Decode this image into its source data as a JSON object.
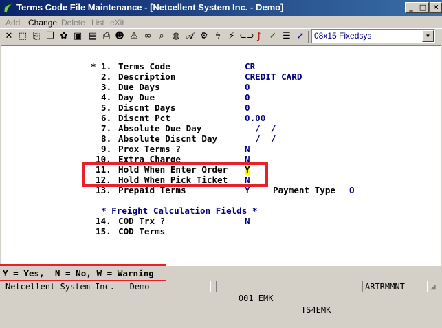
{
  "window": {
    "title": "Terms Code File Maintenance - [Netcellent System Inc. - Demo]",
    "buttons": {
      "minimize": "_",
      "maximize": "□",
      "close": "✕"
    }
  },
  "menu": {
    "add": "Add",
    "change": "Change",
    "delete": "Delete",
    "list": "List",
    "exit": "eXit"
  },
  "toolbar": {
    "font_selector": "08x15 Fixedsys"
  },
  "form": {
    "fields": [
      {
        "marker": "*",
        "num": "1.",
        "label": "Terms Code",
        "value": "CR"
      },
      {
        "marker": "",
        "num": "2.",
        "label": "Description",
        "value": "CREDIT CARD"
      },
      {
        "marker": "",
        "num": "3.",
        "label": "Due Days",
        "value": "0"
      },
      {
        "marker": "",
        "num": "4.",
        "label": "Day Due",
        "value": "0"
      },
      {
        "marker": "",
        "num": "5.",
        "label": "Discnt Days",
        "value": "0"
      },
      {
        "marker": "",
        "num": "6.",
        "label": "Discnt Pct",
        "value": "0.00"
      },
      {
        "marker": "",
        "num": "7.",
        "label": "Absolute Due Day",
        "value": "  /  /"
      },
      {
        "marker": "",
        "num": "8.",
        "label": "Absolute Discnt Day",
        "value": "  /  /"
      },
      {
        "marker": "",
        "num": "9.",
        "label": "Prox Terms ?",
        "value": "N"
      },
      {
        "marker": "",
        "num": "10.",
        "label": "Extra Charge",
        "value": "N"
      },
      {
        "marker": "",
        "num": "11.",
        "label": "Hold When Enter Order",
        "value": "Y"
      },
      {
        "marker": "",
        "num": "12.",
        "label": "Hold When Pick Ticket",
        "value": "N"
      },
      {
        "marker": "",
        "num": "13.",
        "label": "Prepaid Terms",
        "value": "Y"
      }
    ],
    "payment_type_label": "Payment Type",
    "payment_type_value": "O",
    "freight_heading": "* Freight Calculation Fields *",
    "freight_fields": [
      {
        "num": "14.",
        "label": "COD Trx ?",
        "value": "N"
      },
      {
        "num": "15.",
        "label": "COD Terms",
        "value": ""
      }
    ]
  },
  "help": {
    "text": "Y = Yes,  N = No, W = Warning"
  },
  "status": {
    "company": "Netcellent System Inc. - Demo",
    "session": "001 EMK",
    "terminal": "TS4EMK",
    "program": "ARTRMMNT"
  }
}
